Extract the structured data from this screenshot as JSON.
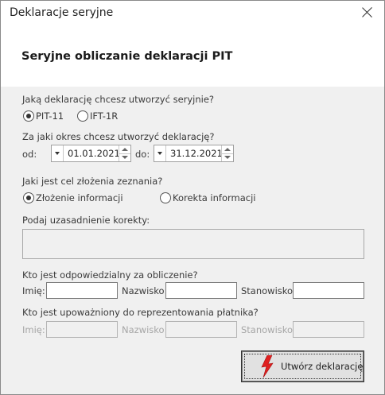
{
  "window": {
    "title": "Deklaracje seryjne"
  },
  "header": {
    "title": "Seryjne obliczanie deklaracji PIT"
  },
  "declaration": {
    "question": "Jaką deklarację chcesz utworzyć seryjnie?",
    "options": [
      "PIT-11",
      "IFT-1R"
    ],
    "selected": "PIT-11"
  },
  "period": {
    "question": "Za jaki okres chcesz utworzyć deklarację?",
    "from_label": "od:",
    "from_value": "01.01.2021",
    "to_label": "do:",
    "to_value": "31.12.2021"
  },
  "purpose": {
    "question": "Jaki jest cel złożenia zeznania?",
    "options": [
      "Złożenie informacji",
      "Korekta informacji"
    ],
    "selected": "Złożenie informacji"
  },
  "correction": {
    "label": "Podaj uzasadnienie korekty:",
    "value": ""
  },
  "responsible": {
    "question": "Kto jest odpowiedzialny za obliczenie?",
    "first_name_label": "Imię:",
    "last_name_label": "Nazwisko:",
    "position_label": "Stanowisko:",
    "first_name": "",
    "last_name": "",
    "position": ""
  },
  "representative": {
    "question": "Kto jest upoważniony do reprezentowania płatnika?",
    "first_name_label": "Imię:",
    "last_name_label": "Nazwisko:",
    "position_label": "Stanowisko:"
  },
  "actions": {
    "create_label": "Utwórz deklarację"
  },
  "icons": {
    "close": "close-icon",
    "create": "lightning-icon"
  },
  "colors": {
    "icon_red": "#e02020",
    "disabled_text": "#a6a6a6"
  }
}
